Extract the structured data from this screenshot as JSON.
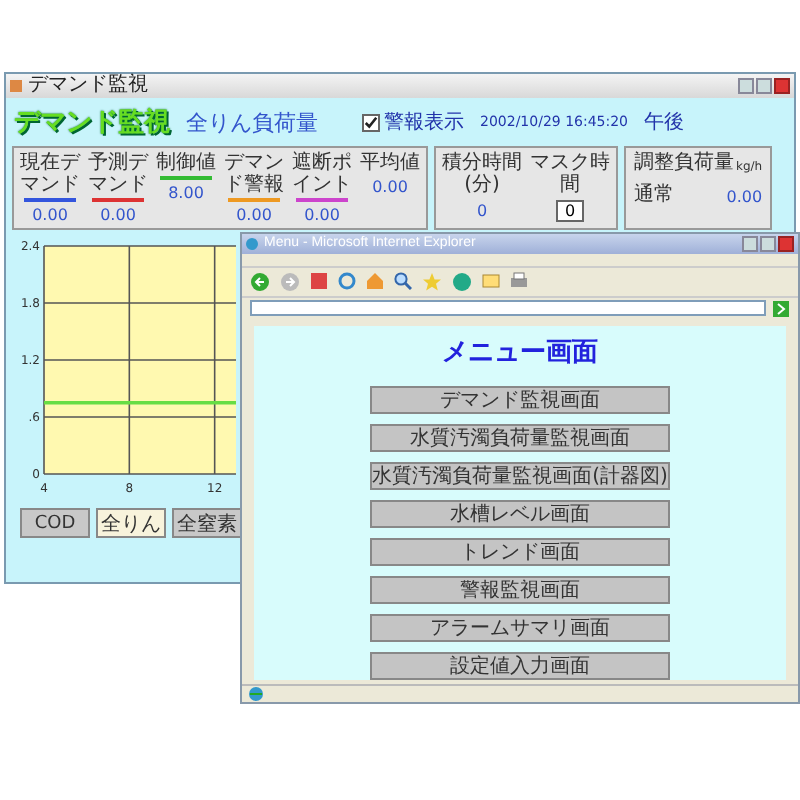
{
  "left_window": {
    "title": "デマンド監視",
    "heading": "デマンド監視",
    "subheading": "全りん負荷量",
    "alarm_display": {
      "label": "警報表示",
      "checked": true
    },
    "datetime": "2002/10/29 16:45:20",
    "period": "午後",
    "indicators": [
      {
        "label": "現在デマンド",
        "value": "0.00",
        "color": "#3355dd"
      },
      {
        "label": "予測デマンド",
        "value": "0.00",
        "color": "#dd3333"
      },
      {
        "label": "制御値",
        "value": "8.00",
        "color": "#33bb33"
      },
      {
        "label": "デマンド警報",
        "value": "0.00",
        "color": "#ee9922"
      },
      {
        "label": "遮断ポイント",
        "value": "0.00",
        "color": "#cc44cc"
      },
      {
        "label": "平均値",
        "value": "0.00"
      }
    ],
    "timers": [
      {
        "label": "積分時間(分)",
        "value": "0",
        "kind": "text"
      },
      {
        "label": "マスク時間",
        "value": "0",
        "kind": "input"
      }
    ],
    "adjust": {
      "label": "調整負荷量",
      "unit": "kg/h",
      "mode": "通常",
      "value": "0.00"
    },
    "chart": {
      "chart_data": {
        "type": "line",
        "grid": true,
        "x": [
          4,
          13
        ],
        "series": [
          {
            "color": "#66dd44",
            "values": [
              0.75,
              0.75
            ]
          }
        ],
        "xlim": [
          4,
          13
        ],
        "ylim": [
          0,
          2.4
        ],
        "xticks": [
          4,
          8,
          12
        ],
        "yticks": [
          {
            "value": 0,
            "label": "0"
          },
          {
            "value": 0.6,
            "label": ".6"
          },
          {
            "value": 1.2,
            "label": "1.2"
          },
          {
            "value": 1.8,
            "label": "1.8"
          },
          {
            "value": 2.4,
            "label": "2.4"
          }
        ]
      }
    },
    "buttons": [
      {
        "label": "COD",
        "selected": false
      },
      {
        "label": "全りん",
        "selected": true
      },
      {
        "label": "全窒素",
        "selected": false
      }
    ]
  },
  "browser": {
    "title": "Menu - Microsoft Internet Explorer",
    "heading": "メニュー画面",
    "menu": [
      {
        "label": "デマンド監視画面"
      },
      {
        "label": "水質汚濁負荷量監視画面"
      },
      {
        "label": "水質汚濁負荷量監視画面(計器図)"
      },
      {
        "label": "水槽レベル画面"
      },
      {
        "label": "トレンド画面"
      },
      {
        "label": "警報監視画面"
      },
      {
        "label": "アラームサマリ画面"
      },
      {
        "label": "設定値入力画面"
      }
    ]
  }
}
